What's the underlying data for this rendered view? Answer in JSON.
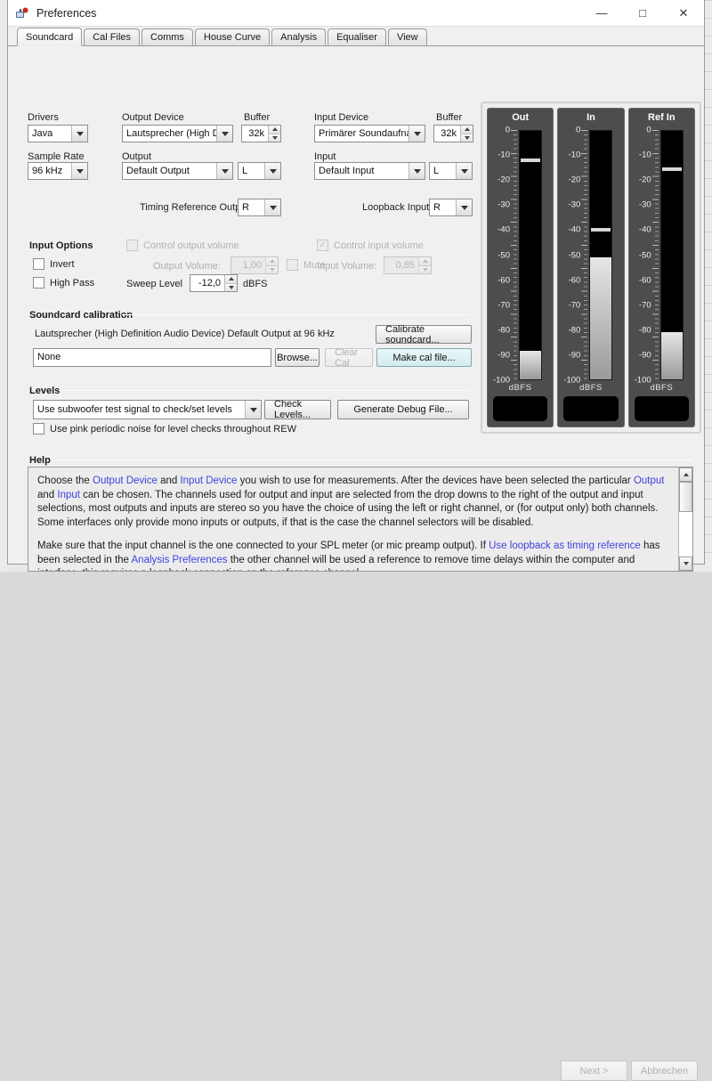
{
  "window": {
    "title": "Preferences",
    "icon": "app-icon",
    "minimize": "—",
    "maximize": "□",
    "close": "✕"
  },
  "tabs": [
    {
      "label": "Soundcard",
      "active": true
    },
    {
      "label": "Cal Files",
      "active": false
    },
    {
      "label": "Comms",
      "active": false
    },
    {
      "label": "House Curve",
      "active": false
    },
    {
      "label": "Analysis",
      "active": false
    },
    {
      "label": "Equaliser",
      "active": false
    },
    {
      "label": "View",
      "active": false
    }
  ],
  "soundcard": {
    "drivers_label": "Drivers",
    "drivers_value": "Java",
    "sample_rate_label": "Sample Rate",
    "sample_rate_value": "96 kHz",
    "output_device_label": "Output Device",
    "output_device_value": "Lautsprecher (High De...",
    "output_buffer_label": "Buffer",
    "output_buffer_value": "32k",
    "output_label": "Output",
    "output_value": "Default Output",
    "output_channel_value": "L",
    "timing_ref_label": "Timing Reference Output",
    "timing_ref_value": "R",
    "input_device_label": "Input Device",
    "input_device_value": "Primärer Soundaufnah...",
    "input_buffer_label": "Buffer",
    "input_buffer_value": "32k",
    "input_label": "Input",
    "input_value": "Default Input",
    "input_channel_value": "L",
    "loopback_label": "Loopback Input",
    "loopback_value": "R"
  },
  "input_options": {
    "title": "Input Options",
    "invert_label": "Invert",
    "invert_checked": false,
    "highpass_label": "High Pass",
    "highpass_checked": false
  },
  "volume": {
    "control_output_label": "Control output volume",
    "control_output_checked": false,
    "control_output_disabled": true,
    "output_volume_label": "Output Volume:",
    "output_volume_value": "1,00",
    "mute_label": "Mute",
    "mute_checked": false,
    "sweep_level_label": "Sweep Level",
    "sweep_level_value": "-12,0",
    "sweep_level_units": "dBFS",
    "control_input_label": "Control input volume",
    "control_input_checked": true,
    "control_input_disabled": true,
    "input_volume_label": "Input Volume:",
    "input_volume_value": "0,85"
  },
  "calibration": {
    "section_title": "Soundcard calibration",
    "device_line": "Lautsprecher (High Definition Audio Device) Default Output at 96 kHz",
    "cal_file_value": "None",
    "browse_label": "Browse...",
    "clear_cal_label": "Clear Cal",
    "calibrate_label": "Calibrate soundcard...",
    "make_cal_label": "Make cal file..."
  },
  "levels": {
    "section_title": "Levels",
    "test_signal_value": "Use subwoofer test signal to check/set levels",
    "check_levels_label": "Check Levels...",
    "debug_file_label": "Generate Debug File...",
    "pink_noise_label": "Use pink periodic noise for level checks throughout REW",
    "pink_noise_checked": false
  },
  "help": {
    "section_title": "Help",
    "paragraph1_parts": [
      {
        "t": "Choose the ",
        "link": false
      },
      {
        "t": "Output Device",
        "link": true
      },
      {
        "t": " and ",
        "link": false
      },
      {
        "t": "Input Device",
        "link": true
      },
      {
        "t": " you wish to use for measurements. After the devices have been selected the particular ",
        "link": false
      },
      {
        "t": "Output",
        "link": true
      },
      {
        "t": " and ",
        "link": false
      },
      {
        "t": "Input",
        "link": true
      },
      {
        "t": " can be chosen. The channels used for output and input are selected from the drop downs to the right of the output and input selections, most outputs and inputs are stereo so you have the choice of using the left or right channel, or (for output only) both channels. Some interfaces only provide mono inputs or outputs, if that is the case the channel selectors will be disabled.",
        "link": false
      }
    ],
    "paragraph2_parts": [
      {
        "t": "Make sure that the input channel is the one connected to your SPL meter (or mic preamp output). If ",
        "link": false
      },
      {
        "t": "Use loopback as timing reference",
        "link": true
      },
      {
        "t": " has been selected in the ",
        "link": false
      },
      {
        "t": "Analysis Preferences",
        "link": true
      },
      {
        "t": " the other channel will be used a reference to remove time delays within the computer and interface, this requires a loopback connection on the reference channel.",
        "link": false
      }
    ],
    "scroll_up_icon": "scroll-up-arrow",
    "scroll_down_icon": "scroll-down-arrow"
  },
  "meters": {
    "units": "dBFS",
    "axis_ticks": [
      "0",
      "-10",
      "-20",
      "-30",
      "-40",
      "-50",
      "-60",
      "-70",
      "-80",
      "-90",
      "-100"
    ],
    "axis_min": -100,
    "axis_max": 0,
    "channels": [
      {
        "name": "Out",
        "level_db": -88.5,
        "peak_db": -12.5,
        "readout": ""
      },
      {
        "name": "In",
        "level_db": -51.0,
        "peak_db": -40.5,
        "readout": ""
      },
      {
        "name": "Ref In",
        "level_db": -81.0,
        "peak_db": -16.0,
        "readout": ""
      }
    ]
  },
  "footer": {
    "next_label": "Next >",
    "next_disabled": true,
    "cancel_label": "Abbrechen",
    "cancel_disabled": true
  },
  "colors": {
    "accent_link": "#4040e0",
    "teal_button": "#d2ecef",
    "meter_panel": "#4d4d4d",
    "waveform_green": "#17a217"
  }
}
